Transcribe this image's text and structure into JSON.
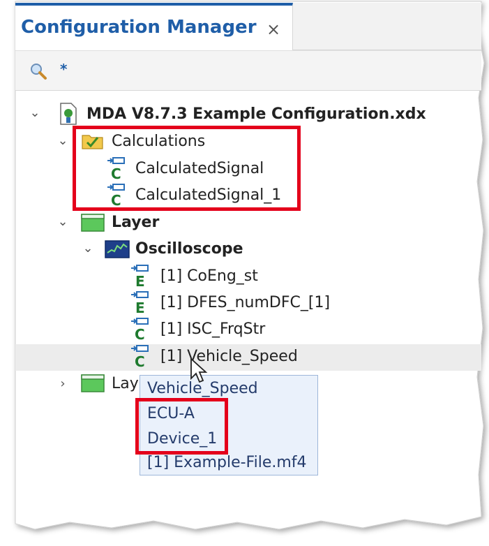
{
  "tab": {
    "title": "Configuration Manager",
    "close": "×"
  },
  "toolbar": {
    "filter_text": "*",
    "search_icon": "search-icon"
  },
  "tree": {
    "root": "MDA V8.7.3 Example Configuration.xdx",
    "calculations": {
      "label": "Calculations",
      "items": [
        "CalculatedSignal",
        "CalculatedSignal_1"
      ]
    },
    "layer": {
      "label": "Layer",
      "oscilloscope": {
        "label": "Oscilloscope",
        "signals": [
          {
            "text": "[1] CoEng_st",
            "type": "E"
          },
          {
            "text": "[1] DFES_numDFC_[1]",
            "type": "E"
          },
          {
            "text": "[1] ISC_FrqStr",
            "type": "C"
          },
          {
            "text": "[1] Vehicle_Speed",
            "type": "C"
          }
        ]
      }
    },
    "layer2": {
      "label": "Lay"
    }
  },
  "tooltip": {
    "lines": [
      "Vehicle_Speed",
      "ECU-A",
      "Device_1",
      "[1] Example-File.mf4"
    ]
  },
  "colors": {
    "accent": "#1f5ea8",
    "highlight": "#e4001b",
    "tooltip_bg": "#eaf1fb"
  }
}
